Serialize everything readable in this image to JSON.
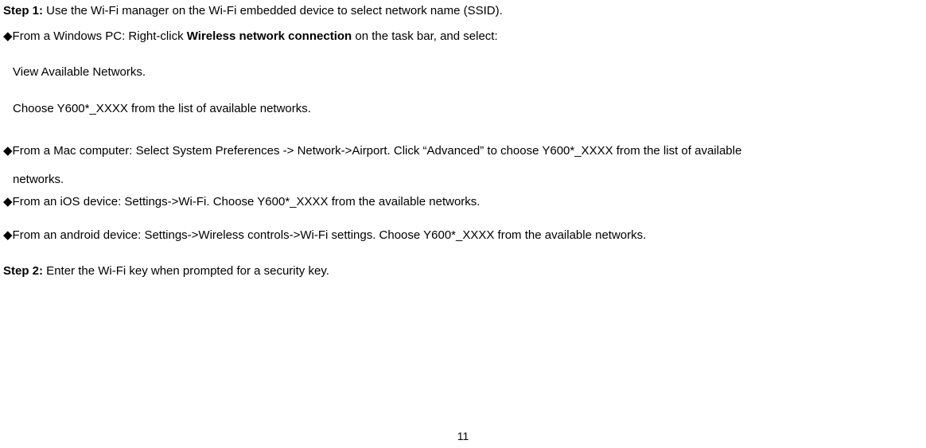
{
  "step1": {
    "label": "Step 1:",
    "text": " Use the Wi-Fi manager on the Wi-Fi embedded device to select network name (SSID)."
  },
  "windows": {
    "bullet": "◆",
    "intro_pre": "From a Windows PC: Right-click ",
    "intro_bold": "Wireless network connection",
    "intro_post": " on the task bar, and select:",
    "sub1": "View Available Networks.",
    "sub2": "Choose Y600*_XXXX from the list of available networks."
  },
  "mac": {
    "bullet": "◆",
    "line1": "From a Mac computer: Select System Preferences -> Network->Airport. Click “Advanced” to choose Y600*_XXXX from the list of available",
    "line2": "networks."
  },
  "ios": {
    "bullet": "◆",
    "text": "From an iOS device: Settings->Wi-Fi. Choose Y600*_XXXX from the available networks."
  },
  "android": {
    "bullet": "◆",
    "text": "From an android device: Settings->Wireless controls->Wi-Fi settings. Choose Y600*_XXXX from the available networks."
  },
  "step2": {
    "label": "Step 2:",
    "text": " Enter the Wi-Fi key when prompted for a security key."
  },
  "page_number": "11"
}
